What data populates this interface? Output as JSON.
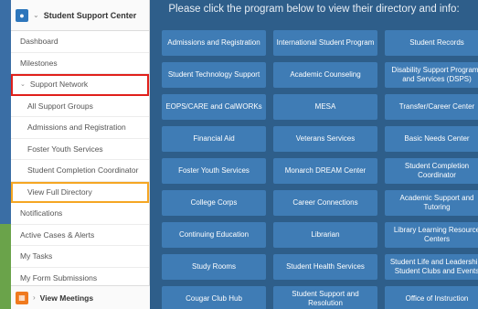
{
  "sidebar": {
    "header_title": "Student Support Center",
    "items": [
      {
        "label": "Dashboard"
      },
      {
        "label": "Milestones"
      },
      {
        "label": "Support Network"
      },
      {
        "label": "All Support Groups"
      },
      {
        "label": "Admissions and Registration"
      },
      {
        "label": "Foster Youth Services"
      },
      {
        "label": "Student Completion Coordinator"
      },
      {
        "label": "View Full Directory"
      },
      {
        "label": "Notifications"
      },
      {
        "label": "Active Cases & Alerts"
      },
      {
        "label": "My Tasks"
      },
      {
        "label": "My Form Submissions"
      }
    ],
    "footer_title": "View Meetings"
  },
  "main": {
    "title": "Please click the program below to view their directory and info:",
    "buttons": [
      {
        "label": "Admissions and Registration"
      },
      {
        "label": "International Student Program"
      },
      {
        "label": "Student Records"
      },
      {
        "label": "Student Technology Support"
      },
      {
        "label": "Academic Counseling"
      },
      {
        "label": "Disability Support Programs and Services (DSPS)"
      },
      {
        "label": "EOPS/CARE and CalWORKs"
      },
      {
        "label": "MESA"
      },
      {
        "label": "Transfer/Career Center"
      },
      {
        "label": "Financial Aid"
      },
      {
        "label": "Veterans Services"
      },
      {
        "label": "Basic Needs Center"
      },
      {
        "label": "Foster Youth Services"
      },
      {
        "label": "Monarch DREAM Center"
      },
      {
        "label": "Student Completion Coordinator"
      },
      {
        "label": "College Corps"
      },
      {
        "label": "Career Connections"
      },
      {
        "label": "Academic Support and Tutoring"
      },
      {
        "label": "Continuing Education"
      },
      {
        "label": "Librarian"
      },
      {
        "label": "Library Learning Resource Centers"
      },
      {
        "label": "Study Rooms"
      },
      {
        "label": "Student Health Services"
      },
      {
        "label": "Student Life and Leadership: Student Clubs and Events"
      },
      {
        "label": "Cougar Club Hub"
      },
      {
        "label": "Student Support and Resolution"
      },
      {
        "label": "Office of Instruction"
      }
    ]
  },
  "colors": {
    "main_bg": "#2e5e8a",
    "button_bg": "#3f7cb5",
    "highlight_red": "#e0201b",
    "highlight_orange": "#f5a623"
  },
  "icons": {
    "header": "user-icon",
    "footer": "calendar-icon"
  }
}
